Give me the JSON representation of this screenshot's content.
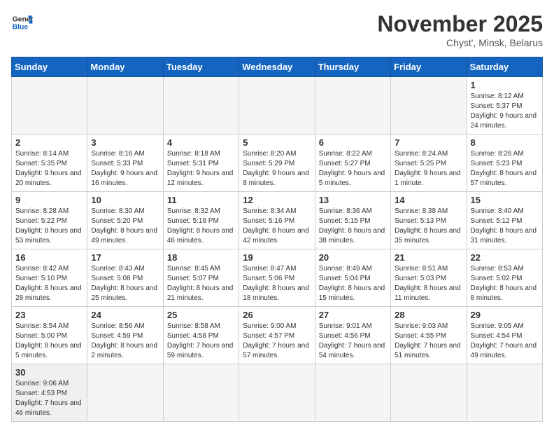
{
  "logo": {
    "text_general": "General",
    "text_blue": "Blue"
  },
  "header": {
    "month": "November 2025",
    "location": "Chyst', Minsk, Belarus"
  },
  "weekdays": [
    "Sunday",
    "Monday",
    "Tuesday",
    "Wednesday",
    "Thursday",
    "Friday",
    "Saturday"
  ],
  "weeks": [
    [
      {
        "num": "",
        "info": "",
        "empty": true
      },
      {
        "num": "",
        "info": "",
        "empty": true
      },
      {
        "num": "",
        "info": "",
        "empty": true
      },
      {
        "num": "",
        "info": "",
        "empty": true
      },
      {
        "num": "",
        "info": "",
        "empty": true
      },
      {
        "num": "",
        "info": "",
        "empty": true
      },
      {
        "num": "1",
        "info": "Sunrise: 8:12 AM\nSunset: 5:37 PM\nDaylight: 9 hours and 24 minutes.",
        "empty": false
      }
    ],
    [
      {
        "num": "2",
        "info": "Sunrise: 8:14 AM\nSunset: 5:35 PM\nDaylight: 9 hours and 20 minutes.",
        "empty": false
      },
      {
        "num": "3",
        "info": "Sunrise: 8:16 AM\nSunset: 5:33 PM\nDaylight: 9 hours and 16 minutes.",
        "empty": false
      },
      {
        "num": "4",
        "info": "Sunrise: 8:18 AM\nSunset: 5:31 PM\nDaylight: 9 hours and 12 minutes.",
        "empty": false
      },
      {
        "num": "5",
        "info": "Sunrise: 8:20 AM\nSunset: 5:29 PM\nDaylight: 9 hours and 8 minutes.",
        "empty": false
      },
      {
        "num": "6",
        "info": "Sunrise: 8:22 AM\nSunset: 5:27 PM\nDaylight: 9 hours and 5 minutes.",
        "empty": false
      },
      {
        "num": "7",
        "info": "Sunrise: 8:24 AM\nSunset: 5:25 PM\nDaylight: 9 hours and 1 minute.",
        "empty": false
      },
      {
        "num": "8",
        "info": "Sunrise: 8:26 AM\nSunset: 5:23 PM\nDaylight: 8 hours and 57 minutes.",
        "empty": false
      }
    ],
    [
      {
        "num": "9",
        "info": "Sunrise: 8:28 AM\nSunset: 5:22 PM\nDaylight: 8 hours and 53 minutes.",
        "empty": false
      },
      {
        "num": "10",
        "info": "Sunrise: 8:30 AM\nSunset: 5:20 PM\nDaylight: 8 hours and 49 minutes.",
        "empty": false
      },
      {
        "num": "11",
        "info": "Sunrise: 8:32 AM\nSunset: 5:18 PM\nDaylight: 8 hours and 46 minutes.",
        "empty": false
      },
      {
        "num": "12",
        "info": "Sunrise: 8:34 AM\nSunset: 5:16 PM\nDaylight: 8 hours and 42 minutes.",
        "empty": false
      },
      {
        "num": "13",
        "info": "Sunrise: 8:36 AM\nSunset: 5:15 PM\nDaylight: 8 hours and 38 minutes.",
        "empty": false
      },
      {
        "num": "14",
        "info": "Sunrise: 8:38 AM\nSunset: 5:13 PM\nDaylight: 8 hours and 35 minutes.",
        "empty": false
      },
      {
        "num": "15",
        "info": "Sunrise: 8:40 AM\nSunset: 5:12 PM\nDaylight: 8 hours and 31 minutes.",
        "empty": false
      }
    ],
    [
      {
        "num": "16",
        "info": "Sunrise: 8:42 AM\nSunset: 5:10 PM\nDaylight: 8 hours and 28 minutes.",
        "empty": false
      },
      {
        "num": "17",
        "info": "Sunrise: 8:43 AM\nSunset: 5:08 PM\nDaylight: 8 hours and 25 minutes.",
        "empty": false
      },
      {
        "num": "18",
        "info": "Sunrise: 8:45 AM\nSunset: 5:07 PM\nDaylight: 8 hours and 21 minutes.",
        "empty": false
      },
      {
        "num": "19",
        "info": "Sunrise: 8:47 AM\nSunset: 5:06 PM\nDaylight: 8 hours and 18 minutes.",
        "empty": false
      },
      {
        "num": "20",
        "info": "Sunrise: 8:49 AM\nSunset: 5:04 PM\nDaylight: 8 hours and 15 minutes.",
        "empty": false
      },
      {
        "num": "21",
        "info": "Sunrise: 8:51 AM\nSunset: 5:03 PM\nDaylight: 8 hours and 11 minutes.",
        "empty": false
      },
      {
        "num": "22",
        "info": "Sunrise: 8:53 AM\nSunset: 5:02 PM\nDaylight: 8 hours and 8 minutes.",
        "empty": false
      }
    ],
    [
      {
        "num": "23",
        "info": "Sunrise: 8:54 AM\nSunset: 5:00 PM\nDaylight: 8 hours and 5 minutes.",
        "empty": false
      },
      {
        "num": "24",
        "info": "Sunrise: 8:56 AM\nSunset: 4:59 PM\nDaylight: 8 hours and 2 minutes.",
        "empty": false
      },
      {
        "num": "25",
        "info": "Sunrise: 8:58 AM\nSunset: 4:58 PM\nDaylight: 7 hours and 59 minutes.",
        "empty": false
      },
      {
        "num": "26",
        "info": "Sunrise: 9:00 AM\nSunset: 4:57 PM\nDaylight: 7 hours and 57 minutes.",
        "empty": false
      },
      {
        "num": "27",
        "info": "Sunrise: 9:01 AM\nSunset: 4:56 PM\nDaylight: 7 hours and 54 minutes.",
        "empty": false
      },
      {
        "num": "28",
        "info": "Sunrise: 9:03 AM\nSunset: 4:55 PM\nDaylight: 7 hours and 51 minutes.",
        "empty": false
      },
      {
        "num": "29",
        "info": "Sunrise: 9:05 AM\nSunset: 4:54 PM\nDaylight: 7 hours and 49 minutes.",
        "empty": false
      }
    ],
    [
      {
        "num": "30",
        "info": "Sunrise: 9:06 AM\nSunset: 4:53 PM\nDaylight: 7 hours and 46 minutes.",
        "empty": false
      },
      {
        "num": "",
        "info": "",
        "empty": true
      },
      {
        "num": "",
        "info": "",
        "empty": true
      },
      {
        "num": "",
        "info": "",
        "empty": true
      },
      {
        "num": "",
        "info": "",
        "empty": true
      },
      {
        "num": "",
        "info": "",
        "empty": true
      },
      {
        "num": "",
        "info": "",
        "empty": true
      }
    ]
  ]
}
